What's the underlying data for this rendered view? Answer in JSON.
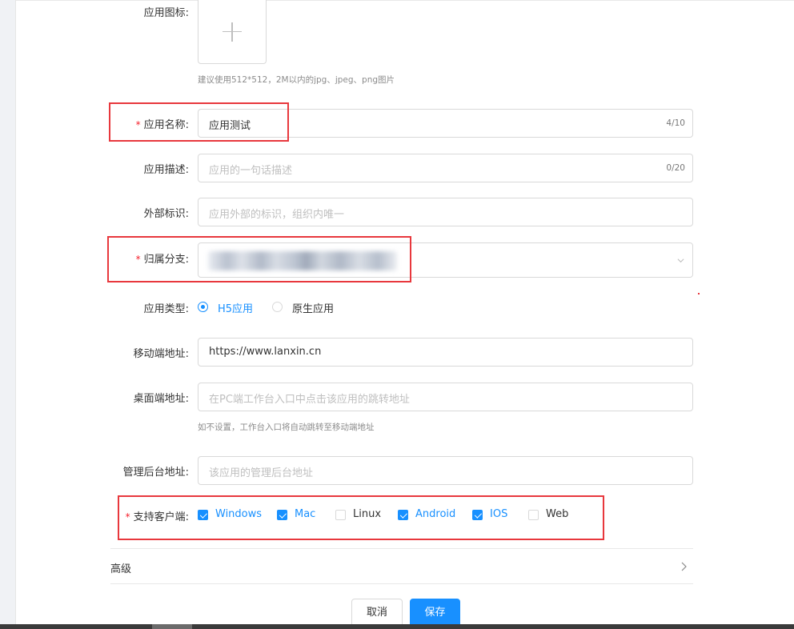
{
  "form": {
    "icon": {
      "label": "应用图标:",
      "hint": "建议使用512*512，2M以内的jpg、jpeg、png图片",
      "icon": "plus-icon"
    },
    "name": {
      "label": "应用名称:",
      "required": "*",
      "value": "应用测试",
      "count": "4/10"
    },
    "description": {
      "label": "应用描述:",
      "placeholder": "应用的一句话描述",
      "count": "0/20"
    },
    "external_id": {
      "label": "外部标识:",
      "placeholder": "应用外部的标识，组织内唯一"
    },
    "branch": {
      "label": "归属分支:",
      "required": "*",
      "icon": "chevron-down-icon"
    },
    "app_type": {
      "label": "应用类型:",
      "options": [
        {
          "label": "H5应用",
          "selected": true
        },
        {
          "label": "原生应用",
          "selected": false
        }
      ]
    },
    "mobile_url": {
      "label": "移动端地址:",
      "value": "https://www.lanxin.cn"
    },
    "desktop_url": {
      "label": "桌面端地址:",
      "placeholder": "在PC端工作台入口中点击该应用的跳转地址",
      "hint": "如不设置，工作台入口将自动跳转至移动端地址"
    },
    "admin_url": {
      "label": "管理后台地址:",
      "placeholder": "该应用的管理后台地址"
    },
    "clients": {
      "label": "支持客户端:",
      "required": "*",
      "options": [
        {
          "label": "Windows",
          "checked": true
        },
        {
          "label": "Mac",
          "checked": true
        },
        {
          "label": "Linux",
          "checked": false
        },
        {
          "label": "Android",
          "checked": true
        },
        {
          "label": "IOS",
          "checked": true
        },
        {
          "label": "Web",
          "checked": false
        }
      ]
    }
  },
  "advanced": {
    "label": "高级",
    "icon": "chevron-right-icon"
  },
  "actions": {
    "cancel": "取消",
    "save": "保存"
  },
  "colors": {
    "primary": "#1890ff",
    "required": "#f5222d",
    "highlight": "#e8383d"
  }
}
